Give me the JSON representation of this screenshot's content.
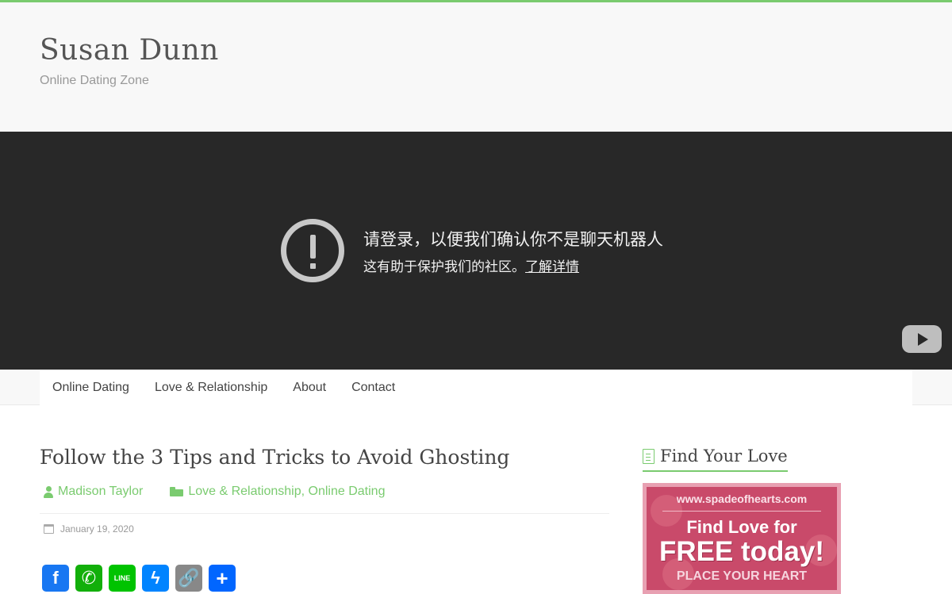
{
  "header": {
    "site_title": "Susan Dunn",
    "tagline": "Online Dating Zone"
  },
  "video": {
    "message_main": "请登录，以便我们确认你不是聊天机器人",
    "message_sub": "这有助于保护我们的社区。",
    "learn_more": "了解详情",
    "icons": [
      "warning-icon",
      "youtube-icon"
    ]
  },
  "nav": {
    "items": [
      {
        "label": "Online Dating"
      },
      {
        "label": "Love & Relationship"
      },
      {
        "label": "About"
      },
      {
        "label": "Contact"
      }
    ]
  },
  "post": {
    "title": "Follow the 3 Tips and Tricks to Avoid Ghosting",
    "author": "Madison Taylor",
    "categories": "Love & Relationship, Online Dating",
    "date": "January 19, 2020",
    "share_buttons": [
      {
        "name": "facebook",
        "glyph": "f"
      },
      {
        "name": "whatsapp",
        "glyph": "✆"
      },
      {
        "name": "line",
        "glyph": "LINE"
      },
      {
        "name": "messenger",
        "glyph": "ϟ"
      },
      {
        "name": "copy-link",
        "glyph": "🔗"
      },
      {
        "name": "share",
        "glyph": "+"
      }
    ]
  },
  "sidebar": {
    "widget_title": "Find Your Love",
    "ad": {
      "url": "www.spadeofhearts.com",
      "line1": "Find Love for",
      "line2": "FREE today!",
      "line3": "PLACE YOUR HEART"
    }
  },
  "colors": {
    "accent": "#7acb6f",
    "video_bg": "#282828"
  }
}
